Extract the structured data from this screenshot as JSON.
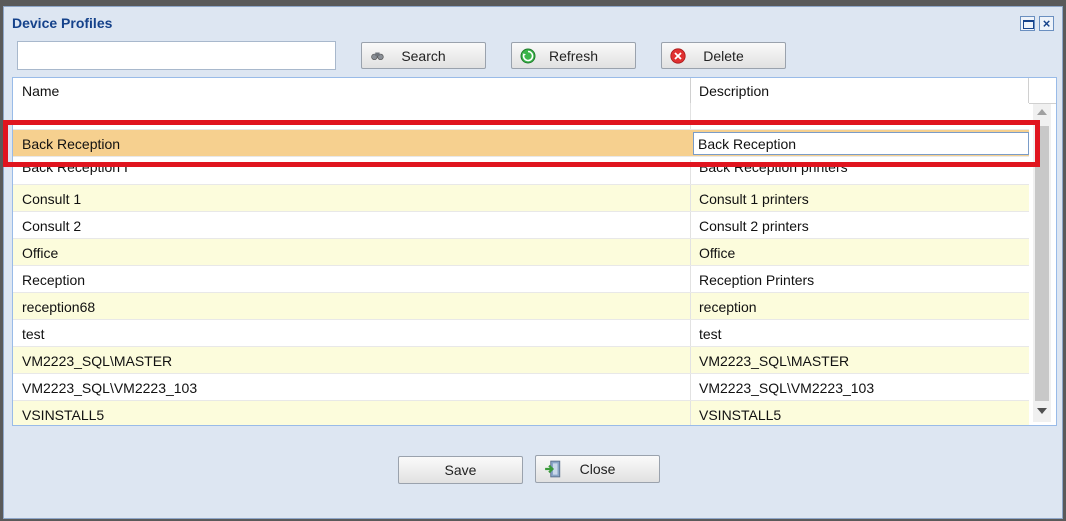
{
  "window": {
    "title": "Device Profiles"
  },
  "toolbar": {
    "search_value": "",
    "search_label": "Search",
    "refresh_label": "Refresh",
    "delete_label": "Delete"
  },
  "grid": {
    "columns": [
      "Name",
      "Description"
    ],
    "editing_row": {
      "name": "Back Reception",
      "description": "Back Reception"
    },
    "rows": [
      {
        "name": "Back Reception I",
        "description": "Back Reception printers"
      },
      {
        "name": "Consult 1",
        "description": "Consult 1 printers"
      },
      {
        "name": "Consult 2",
        "description": "Consult 2 printers"
      },
      {
        "name": "Office",
        "description": "Office"
      },
      {
        "name": "Reception",
        "description": "Reception Printers"
      },
      {
        "name": "reception68",
        "description": "reception"
      },
      {
        "name": "test",
        "description": "test"
      },
      {
        "name": "VM2223_SQL\\MASTER",
        "description": "VM2223_SQL\\MASTER"
      },
      {
        "name": "VM2223_SQL\\VM2223_103",
        "description": "VM2223_SQL\\VM2223_103"
      },
      {
        "name": "VSINSTALL5",
        "description": "VSINSTALL5"
      }
    ]
  },
  "footer": {
    "save_label": "Save",
    "close_label": "Close"
  },
  "colors": {
    "selected_row": "#f6d08f",
    "alt_row": "#fcfcdc",
    "highlight_border": "#e0141e",
    "title": "#15428b"
  },
  "icons": {
    "search": "binoculars-icon",
    "refresh": "refresh-icon",
    "delete": "delete-icon",
    "close": "exit-door-icon"
  }
}
